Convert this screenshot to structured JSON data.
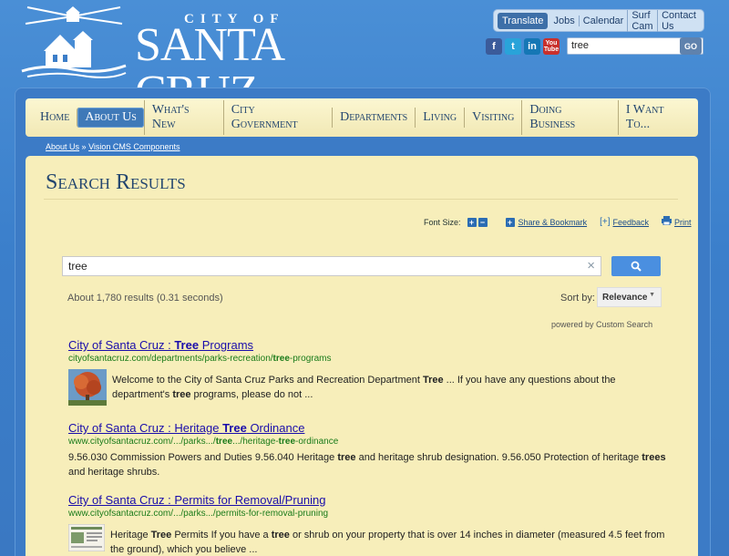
{
  "header": {
    "city_of": "CITY OF",
    "city_name": "SANTA CRUZ",
    "top_links": [
      "Translate",
      "Jobs",
      "Calendar",
      "Surf Cam",
      "Contact Us"
    ],
    "social": {
      "facebook": "f",
      "twitter": "t",
      "linkedin": "in",
      "youtube": "You Tube"
    },
    "search_value": "tree",
    "go_label": "GO"
  },
  "mainnav": {
    "items": [
      "Home",
      "About Us",
      "What's New",
      "City Government",
      "Departments",
      "Living",
      "Visiting",
      "Doing Business",
      "I Want To..."
    ],
    "active": "About Us"
  },
  "breadcrumb": {
    "items": [
      "About Us",
      "Vision CMS Components"
    ],
    "separator": "»"
  },
  "page": {
    "title": "Search Results",
    "font_size_label": "Font Size:",
    "font_plus": "+",
    "font_minus": "−",
    "share_label": "Share & Bookmark",
    "feedback_icon": "[+]",
    "feedback_label": "Feedback",
    "print_label": "Print"
  },
  "search": {
    "query": "tree",
    "result_count": "About 1,780 results (0.31 seconds)",
    "sort_label": "Sort by:",
    "sort_value": "Relevance",
    "powered_by": "powered by",
    "powered_brand": "Custom Search"
  },
  "results": [
    {
      "title_pre": "City of Santa Cruz : ",
      "title_bold": "Tree",
      "title_post": " Programs",
      "url_pre": "cityofsantacruz.com/departments/parks-recreation/",
      "url_bold": "tree",
      "url_post": "-programs",
      "snippet": [
        {
          "t": "Welcome to the City of Santa Cruz Parks and Recreation Department ",
          "b": false
        },
        {
          "t": "Tree",
          "b": true
        },
        {
          "t": " ... If you have any questions about the department's ",
          "b": false
        },
        {
          "t": "tree",
          "b": true
        },
        {
          "t": " programs, please do not ...",
          "b": false
        }
      ]
    },
    {
      "title_pre": "City of Santa Cruz : Heritage ",
      "title_bold": "Tree",
      "title_post": " Ordinance",
      "url_pre": "www.cityofsantacruz.com/.../parks.../",
      "url_bold": "tree",
      "url_mid": ".../heritage-",
      "url_bold2": "tree",
      "url_post": "-ordinance",
      "snippet": [
        {
          "t": "9.56.030 Commission Powers and Duties 9.56.040 Heritage ",
          "b": false
        },
        {
          "t": "tree",
          "b": true
        },
        {
          "t": " and heritage shrub designation. 9.56.050 Protection of heritage ",
          "b": false
        },
        {
          "t": "trees",
          "b": true
        },
        {
          "t": " and heritage shrubs.",
          "b": false
        }
      ]
    },
    {
      "title": "City of Santa Cruz : Permits for Removal/Pruning",
      "url": "www.cityofsantacruz.com/.../parks.../permits-for-removal-pruning",
      "snippet": [
        {
          "t": "Heritage ",
          "b": false
        },
        {
          "t": "Tree",
          "b": true
        },
        {
          "t": " Permits If you have a ",
          "b": false
        },
        {
          "t": "tree",
          "b": true
        },
        {
          "t": " or shrub on your property that is over 14 inches in diameter (measured 4.5 feet from the ground), which you believe ...",
          "b": false
        }
      ]
    }
  ]
}
